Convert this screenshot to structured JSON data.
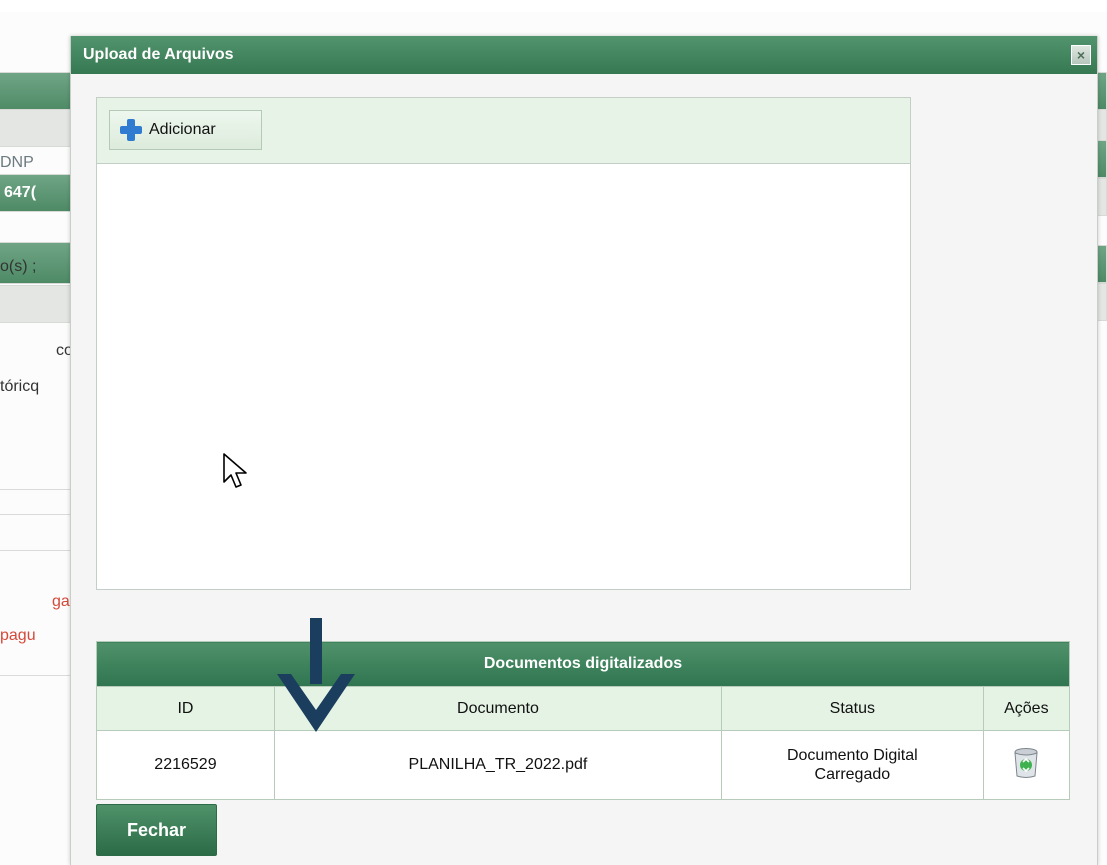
{
  "background": {
    "fragments": [
      "DNP ",
      "647(",
      "o(s) ;",
      "co",
      "tóricq",
      "ga",
      "pagu"
    ]
  },
  "modal": {
    "title": "Upload de Arquivos",
    "close_symbol": "×"
  },
  "uploader": {
    "add_label": "Adicionar",
    "add_icon": "plus-icon"
  },
  "documents": {
    "caption": "Documentos digitalizados",
    "columns": [
      "ID",
      "Documento",
      "Status",
      "Ações"
    ],
    "rows": [
      {
        "id": "2216529",
        "documento": "PLANILHA_TR_2022.pdf",
        "status_line1": "Documento Digital",
        "status_line2": "Carregado",
        "action_icon": "recycle-bin-icon"
      }
    ]
  },
  "footer": {
    "close_label": "Fechar"
  },
  "colors": {
    "header_green": "#357852",
    "toolbar_green": "#e6f3e6",
    "annotation_arrow": "#1b3e5e",
    "add_icon_blue": "#2f7bd1"
  }
}
